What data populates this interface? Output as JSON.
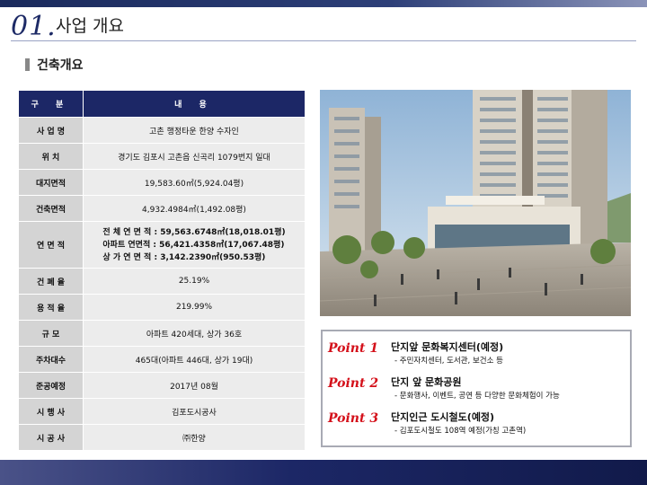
{
  "header": {
    "number": "01.",
    "title": "사업 개요"
  },
  "section": {
    "title": "건축개요"
  },
  "table": {
    "header": [
      "구 분",
      "내 용"
    ],
    "rows": [
      {
        "label": "사 업 명",
        "value": "고촌 행정타운 한양 수자인"
      },
      {
        "label": "위 치",
        "value": "경기도 김포시 고촌읍 신곡리 1079번지 일대"
      },
      {
        "label": "대지면적",
        "value": "19,583.60㎡(5,924.04평)"
      },
      {
        "label": "건축면적",
        "value": "4,932.4984㎡(1,492.08평)"
      },
      {
        "label": "연 면 적",
        "lines": [
          "전 체 연 면 적 : 59,563.6748㎡(18,018.01평)",
          "아파트 연면적 : 56,421.4358㎡(17,067.48평)",
          "상 가 연 면 적 :  3,142.2390㎡(950.53평)"
        ]
      },
      {
        "label": "건 폐 율",
        "value": "25.19%"
      },
      {
        "label": "용 적 율",
        "value": "219.99%"
      },
      {
        "label": "규 모",
        "value": "아파트 420세대, 상가 36호"
      },
      {
        "label": "주차대수",
        "value": "465대(아파트 446대, 상가 19대)"
      },
      {
        "label": "준공예정",
        "value": "2017년 08월"
      },
      {
        "label": "시 행 사",
        "value": "김포도시공사"
      },
      {
        "label": "시 공 사",
        "value": "㈜한양"
      }
    ]
  },
  "points": [
    {
      "label": "Point 1",
      "title": "단지앞 문화복지센터(예정)",
      "detail": "- 주민자치센터, 도서관, 보건소 등"
    },
    {
      "label": "Point 2",
      "title": "단지 앞 문화공원",
      "detail": "- 문화행사, 이벤트, 공연 등 다양한 문화체험이 가능"
    },
    {
      "label": "Point 3",
      "title": "단지인근 도시철도(예정)",
      "detail": "- 김포도시철도 108역 예정(가칭 고촌역)"
    }
  ],
  "colors": {
    "navy": "#1c2766",
    "point_red": "#d4101a",
    "label_gray": "#d4d4d4",
    "value_gray": "#ececec"
  },
  "image": {
    "subject": "rendering of apartment complex and commercial plaza"
  }
}
